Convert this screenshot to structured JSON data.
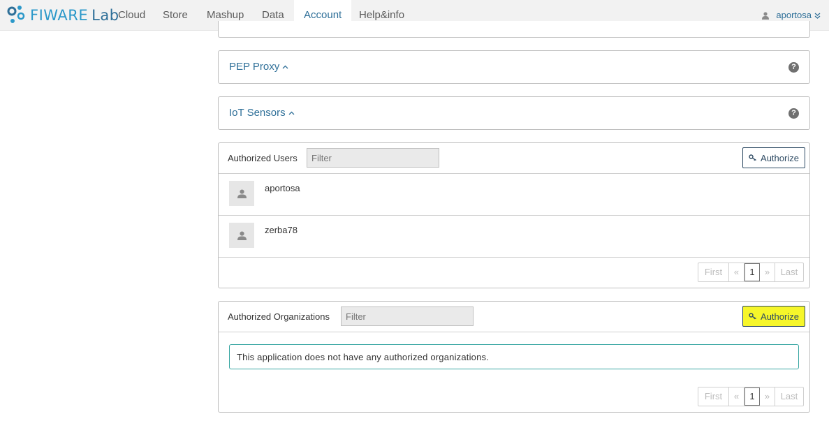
{
  "brand": {
    "name_part1": "FIWARE",
    "name_part2": "Lab"
  },
  "nav": {
    "items": [
      {
        "label": "Cloud"
      },
      {
        "label": "Store"
      },
      {
        "label": "Mashup"
      },
      {
        "label": "Data"
      },
      {
        "label": "Account"
      },
      {
        "label": "Help&info"
      }
    ],
    "active": "Account"
  },
  "user_menu": {
    "username": "aportosa"
  },
  "sections": {
    "pep_proxy": {
      "title": "PEP Proxy",
      "help": "?"
    },
    "iot_sensors": {
      "title": "IoT Sensors",
      "help": "?"
    }
  },
  "authorized_users": {
    "label": "Authorized Users",
    "filter_placeholder": "Filter",
    "authorize_label": "Authorize",
    "users": [
      {
        "name": "aportosa"
      },
      {
        "name": "zerba78"
      }
    ],
    "pagination": {
      "first": "First",
      "prev": "«",
      "page": "1",
      "next": "»",
      "last": "Last"
    }
  },
  "authorized_organizations": {
    "label": "Authorized Organizations",
    "filter_placeholder": "Filter",
    "authorize_label": "Authorize",
    "empty_message": "This application does not have any authorized organizations.",
    "pagination": {
      "first": "First",
      "prev": "«",
      "page": "1",
      "next": "»",
      "last": "Last"
    }
  },
  "colors": {
    "brand_blue": "#2b98c9",
    "link_blue": "#2e6f98",
    "highlight": "#f6f62a",
    "info_border": "#3aa7a3"
  }
}
